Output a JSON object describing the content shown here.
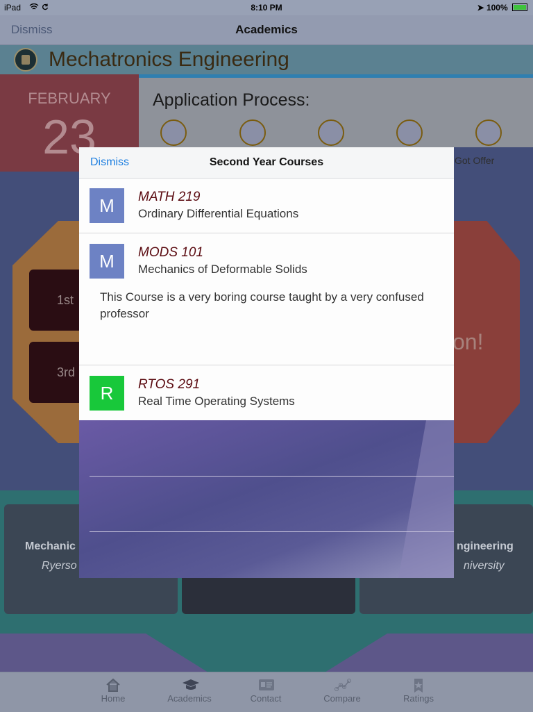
{
  "status_bar": {
    "device": "iPad",
    "time": "8:10 PM",
    "battery": "100%"
  },
  "nav": {
    "dismiss_label": "Dismiss",
    "title": "Academics"
  },
  "program": {
    "title": "Mechatronics Engineering"
  },
  "date": {
    "month": "FEBRUARY",
    "day": "23"
  },
  "application": {
    "heading": "Application Process:",
    "visible_step_label": "Got Offer"
  },
  "year_buttons": [
    "1st",
    "3rd"
  ],
  "partial_text": "on!",
  "image_cards": [
    {
      "caption": "Mechanic",
      "sub": "Ryerso"
    },
    {
      "caption": "ngineering",
      "sub": "niversity"
    }
  ],
  "popover": {
    "dismiss_label": "Dismiss",
    "title": "Second Year Courses",
    "courses": [
      {
        "letter": "M",
        "code": "MATH 219",
        "name": "Ordinary Differential Equations",
        "color": "#6d82c4"
      },
      {
        "letter": "M",
        "code": "MODS 101",
        "name": "Mechanics of Deformable Solids",
        "color": "#6d82c4",
        "description": "This Course is a very boring course taught by a very confused professor"
      },
      {
        "letter": "R",
        "code": "RTOS 291",
        "name": "Real Time Operating Systems",
        "color": "#18c83a"
      }
    ]
  },
  "tabs": [
    {
      "label": "Home",
      "icon": "home-icon"
    },
    {
      "label": "Academics",
      "icon": "graduation-cap-icon"
    },
    {
      "label": "Contact",
      "icon": "contact-card-icon"
    },
    {
      "label": "Compare",
      "icon": "compare-graph-icon"
    },
    {
      "label": "Ratings",
      "icon": "ribbon-star-icon"
    }
  ]
}
